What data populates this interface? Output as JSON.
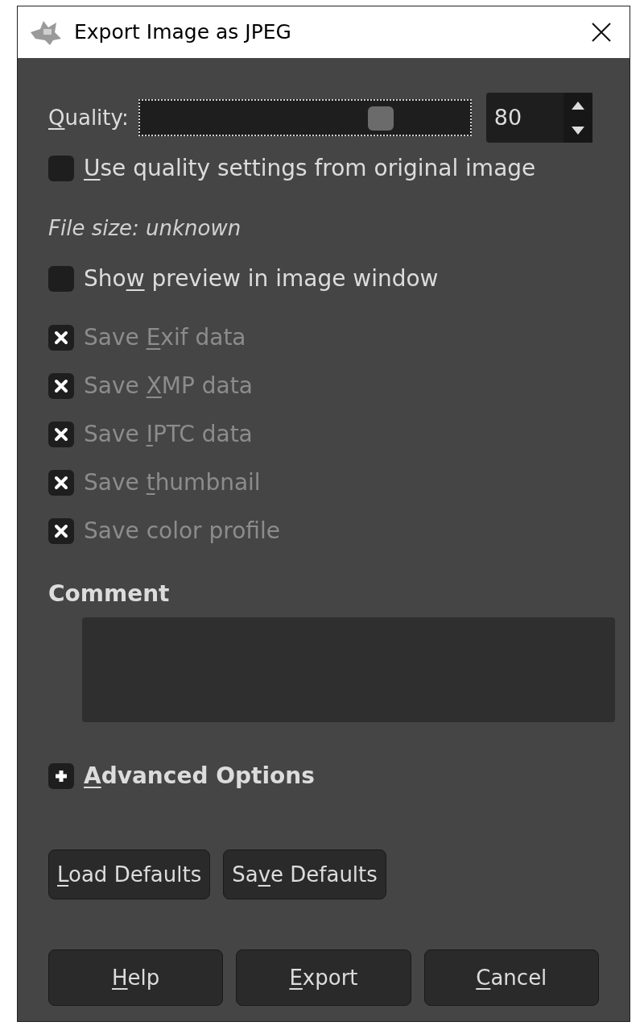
{
  "window": {
    "title": "Export Image as JPEG"
  },
  "quality": {
    "label": {
      "key": "Q",
      "post": "uality:"
    },
    "level": 0.73,
    "value": "80"
  },
  "options": [
    {
      "label": {
        "key": "U",
        "post": "se quality settings from original image"
      },
      "checked": false,
      "disabled": false
    },
    {
      "label": {
        "pre": "Sho",
        "key": "w",
        "post": " preview in image window"
      },
      "checked": false,
      "disabled": false
    },
    {
      "label": {
        "pre": "Save ",
        "key": "E",
        "post": "xif data"
      },
      "checked": true,
      "disabled": true
    },
    {
      "label": {
        "pre": "Save ",
        "key": "X",
        "post": "MP data"
      },
      "checked": true,
      "disabled": true
    },
    {
      "label": {
        "pre": "Save ",
        "key": "I",
        "post": "PTC data"
      },
      "checked": true,
      "disabled": true
    },
    {
      "label": {
        "pre": "Save ",
        "key": "t",
        "post": "humbnail"
      },
      "checked": true,
      "disabled": true
    },
    {
      "label": {
        "pre": "Save color profile"
      },
      "checked": true,
      "disabled": true
    }
  ],
  "file_size": "File size: unknown",
  "comment": {
    "label": "Comment"
  },
  "advanced": {
    "label": {
      "key": "A",
      "post": "dvanced Options"
    },
    "expanded": false
  },
  "default_buttons": [
    {
      "key": "L",
      "post": "oad Defaults"
    },
    {
      "pre": "Sa",
      "key": "v",
      "post": "e Defaults"
    }
  ],
  "buttons": [
    {
      "key": "H",
      "post": "elp"
    },
    {
      "key": "E",
      "post": "xport"
    },
    {
      "key": "C",
      "post": "ancel"
    }
  ]
}
